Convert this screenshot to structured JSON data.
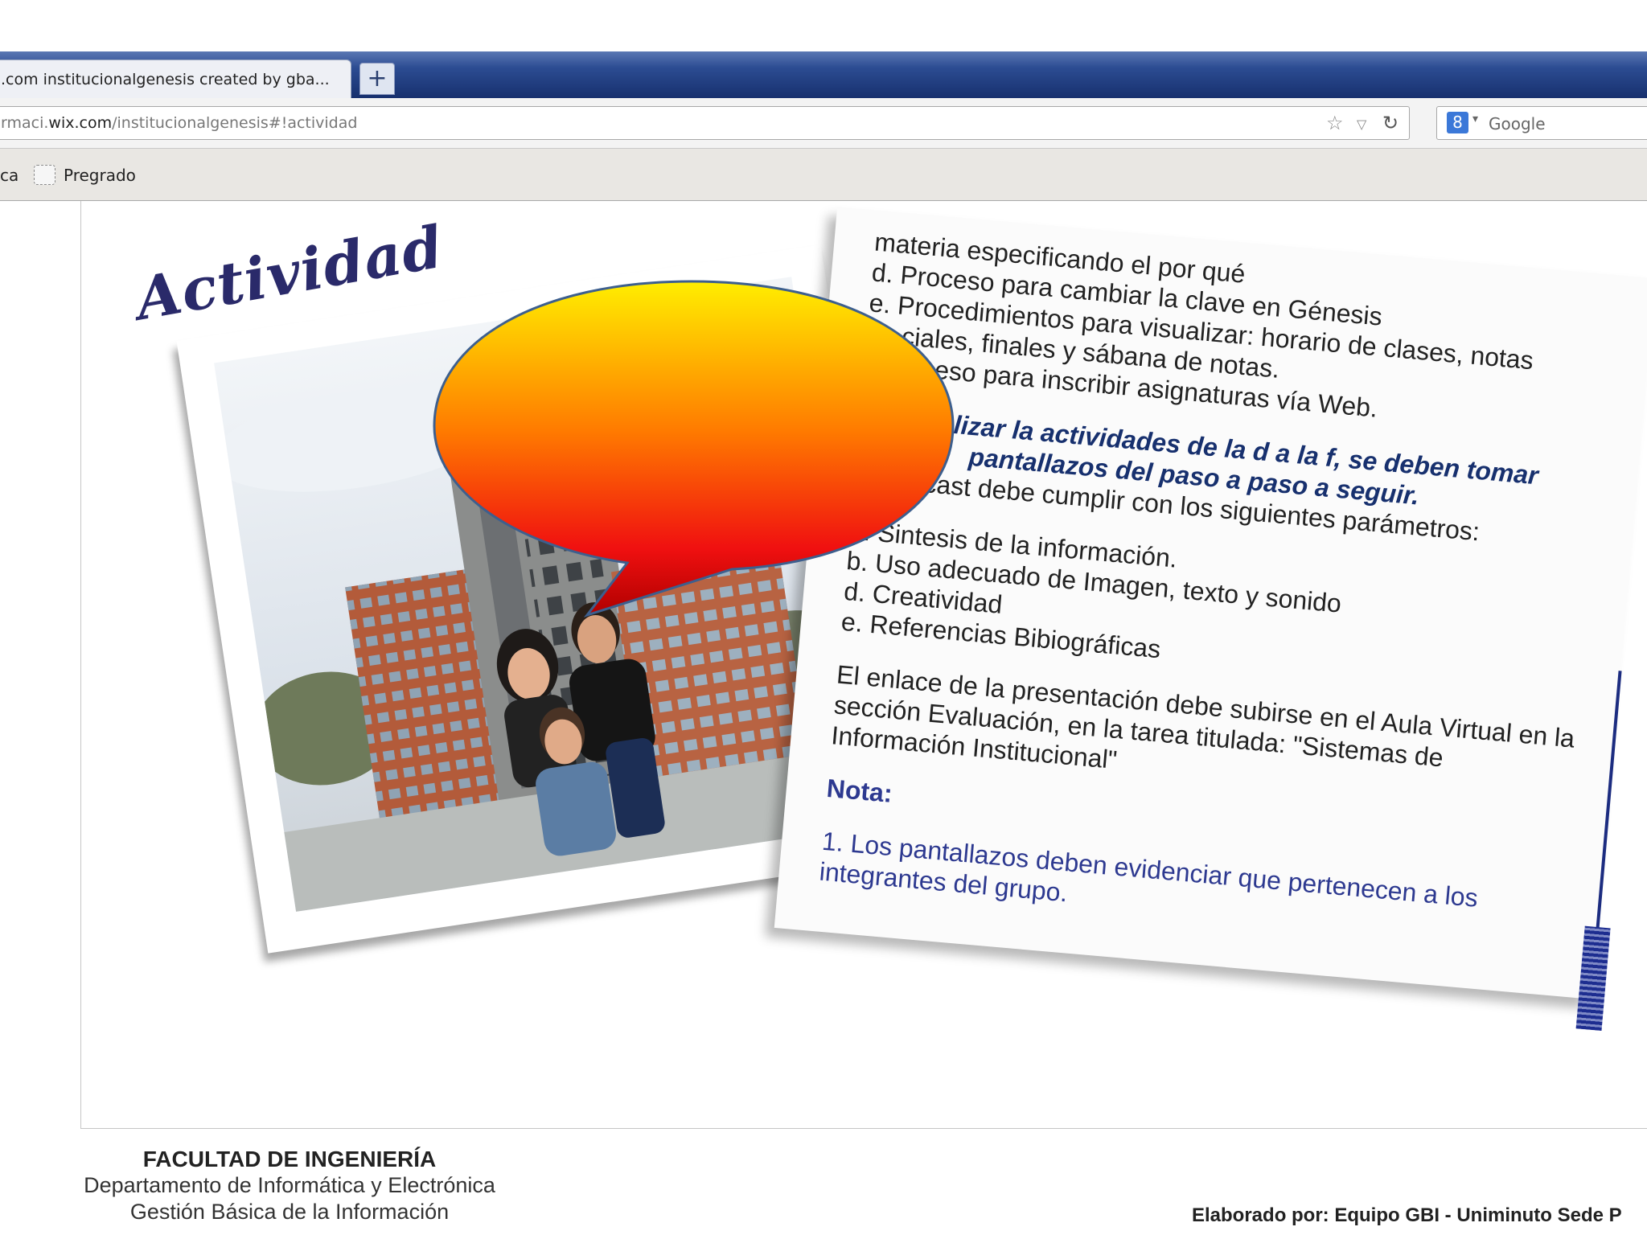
{
  "browser": {
    "tab_title": ".com institucionalgenesis created by gba...",
    "new_tab_label": "+",
    "url_prefix": "rmaci.",
    "url_host": "wix.com",
    "url_path": "/institucionalgenesis#!actividad",
    "search_engine_label": "Google",
    "bookmarks": [
      "ca",
      "Pregrado"
    ]
  },
  "page": {
    "title": "Actividad",
    "paper_lines": [
      "materia especificando el por qué",
      "d. Proceso para cambiar la clave en Génesis",
      "e. Procedimientos para visualizar: horario de clases, notas",
      "ciales, finales y sábana de notas.",
      "roceso para inscribir asignaturas vía Web."
    ],
    "emphasis_line1": "realizar la actividades de la d a la f, se deben tomar",
    "emphasis_line2": "pantallazos del paso a paso a seguir.",
    "slidecast_intro": "l Slidecast debe cumplir con los siguientes parámetros:",
    "parameters": [
      "a. Sintesis de la información.",
      "b. Uso adecuado de Imagen, texto y sonido",
      "d. Creatividad",
      "e. Referencias Bibiográficas"
    ],
    "link_paragraph": "El enlace de la presentación debe subirse en el Aula Virtual en la sección Evaluación, en la tarea titulada: \"Sistemas de Información Institucional\"",
    "note_label": "Nota:",
    "note_text": "1. Los pantallazos deben evidenciar que pertenecen a los integrantes del grupo."
  },
  "footer": {
    "faculty": "FACULTAD DE INGENIERÍA",
    "department": "Departamento de Informática y Electrónica",
    "course": "Gestión Básica de la Información",
    "credit": "Elaborado por: Equipo GBI - Uniminuto Sede P"
  },
  "colors": {
    "tab_strip": "#1c3677",
    "title_ink": "#2a2a6a",
    "emphasis_blue": "#17306e",
    "bubble_top": "#ffee00",
    "bubble_bottom": "#c00000"
  }
}
